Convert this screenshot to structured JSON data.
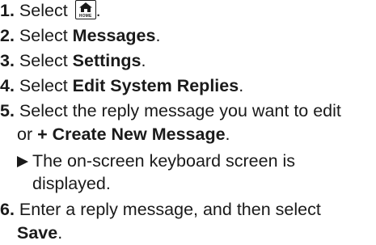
{
  "steps": [
    {
      "number": "1.",
      "text": "Select",
      "icon": "home-icon",
      "icon_label": "HOME",
      "suffix": "."
    },
    {
      "number": "2.",
      "text": "Select ",
      "bold": "Messages",
      "suffix": "."
    },
    {
      "number": "3.",
      "text": "Select ",
      "bold": "Settings",
      "suffix": "."
    },
    {
      "number": "4.",
      "text": "Select ",
      "bold": "Edit System Replies",
      "suffix": "."
    },
    {
      "number": "5.",
      "text": "Select the reply message you want to edit",
      "cont_text": "or ",
      "cont_bold": "+ Create New Message",
      "cont_suffix": "."
    },
    {
      "note_text": "The on-screen keyboard screen is",
      "note_cont": "displayed."
    },
    {
      "number": "6.",
      "text": "Enter a reply message, and then select",
      "cont_bold": "Save",
      "cont_suffix": "."
    }
  ]
}
